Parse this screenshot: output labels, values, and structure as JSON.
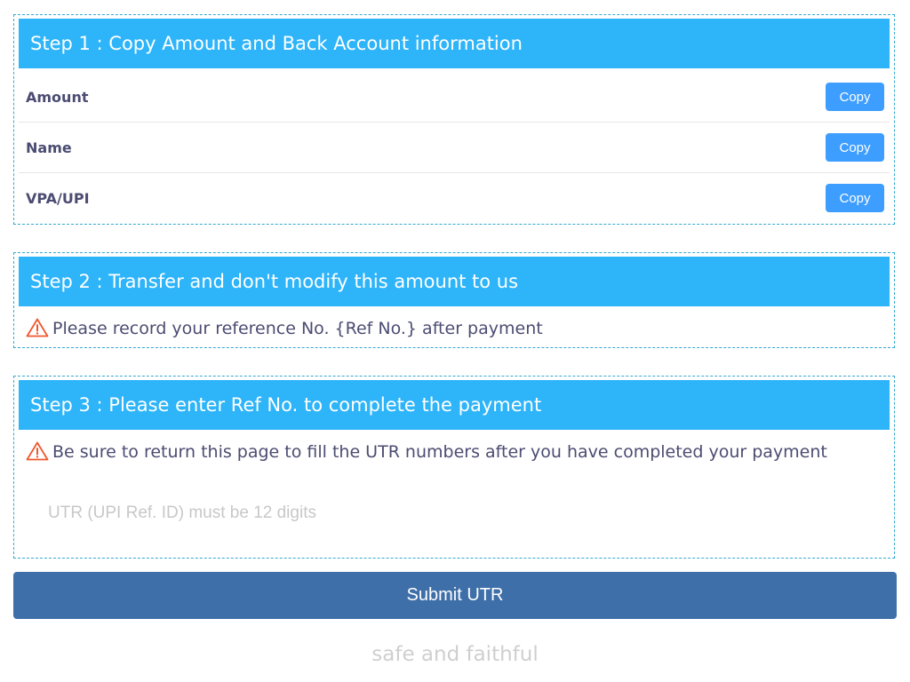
{
  "step1": {
    "title": "Step 1 : Copy Amount and Back Account information",
    "rows": [
      {
        "label": "Amount",
        "button": "Copy"
      },
      {
        "label": "Name",
        "button": "Copy"
      },
      {
        "label": "VPA/UPI",
        "button": "Copy"
      }
    ]
  },
  "step2": {
    "title": "Step 2 : Transfer and don't modify this amount to us",
    "notice": "Please record your reference No. {Ref No.} after payment"
  },
  "step3": {
    "title": "Step 3 : Please enter Ref No. to complete the payment",
    "notice": "Be sure to return this page to fill the UTR numbers after you have completed your payment",
    "input_value": "",
    "input_placeholder": "UTR (UPI Ref. ID) must be 12 digits"
  },
  "submit_label": "Submit UTR",
  "footer_text": "safe and faithful",
  "icons": {
    "notice": "warning-triangle-icon"
  },
  "colors": {
    "header_bg": "#2eb4f9",
    "copy_button": "#3d9eff",
    "submit_button": "#3f6fa9",
    "warning": "#f0562d",
    "label_text": "#4b4c72",
    "border": "#36a9cf"
  }
}
